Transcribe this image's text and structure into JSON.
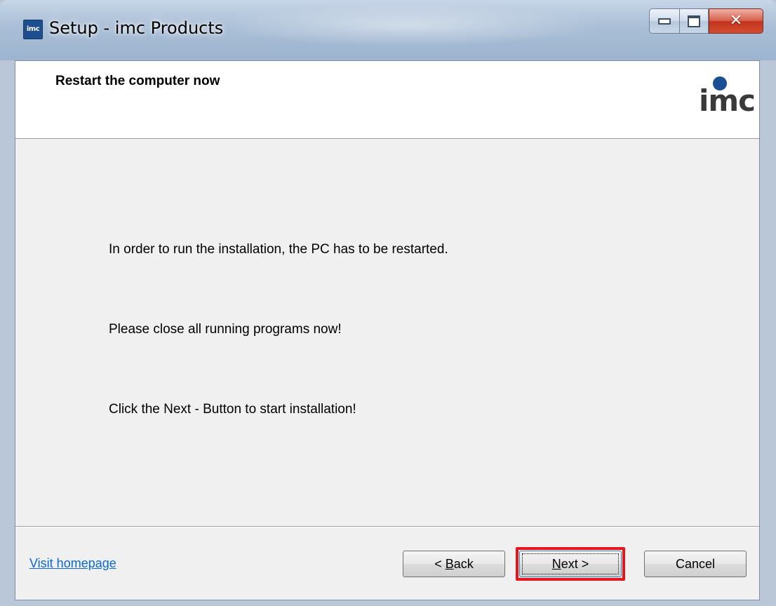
{
  "window": {
    "icon_label": "imc",
    "title": "Setup - imc Products"
  },
  "header": {
    "title": "Restart the computer now",
    "logo_text": "imc"
  },
  "messages": [
    "In order to run the installation, the PC has to be restarted.",
    "Please close all running programs now!",
    "Click the Next - Button to start installation!"
  ],
  "footer": {
    "visit_link": "Visit homepage",
    "back": {
      "prefix": "< ",
      "mnemonic": "B",
      "rest": "ack"
    },
    "next": {
      "mnemonic": "N",
      "rest": "ext >"
    },
    "cancel": "Cancel"
  },
  "colors": {
    "logo_dot": "#1b4f93",
    "link": "#0a67d8",
    "highlight": "#e8141b"
  }
}
